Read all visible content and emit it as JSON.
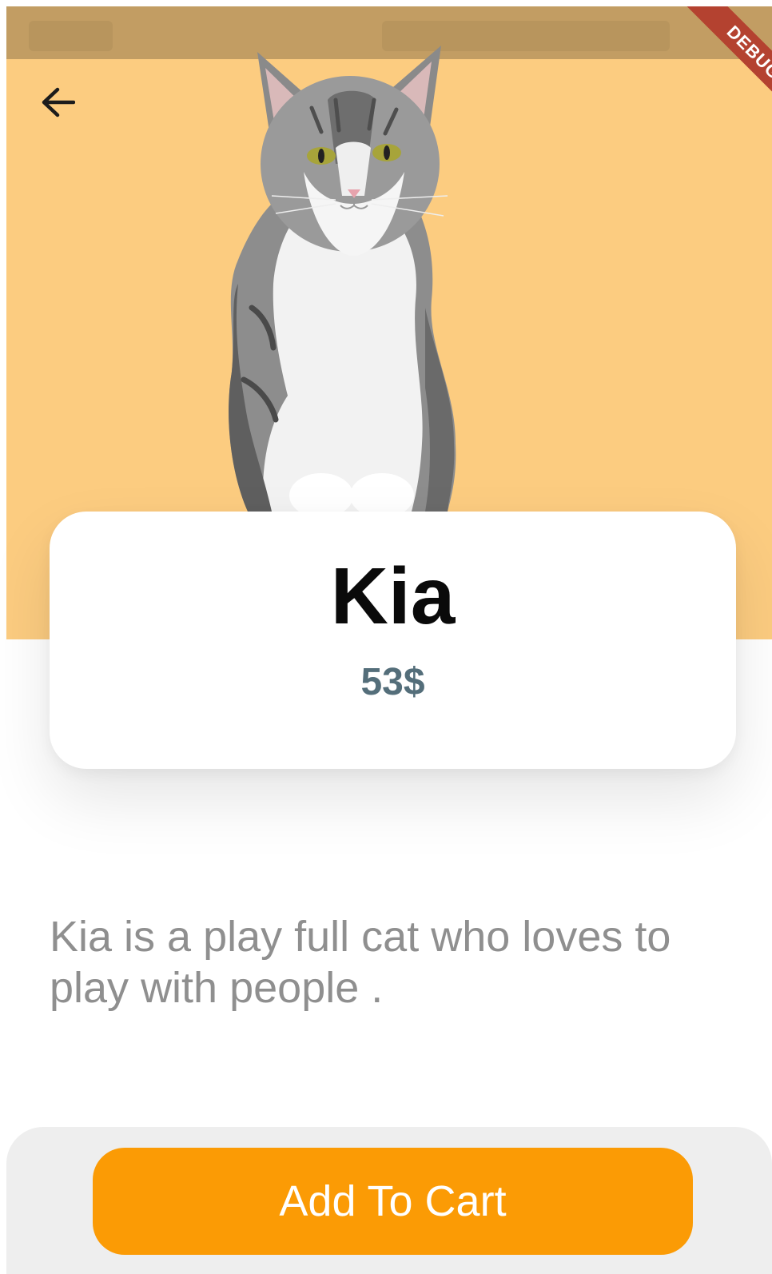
{
  "ribbon": {
    "label": "DEBUG"
  },
  "pet": {
    "name": "Kia",
    "price": "53$",
    "description": "Kia is a play full cat who loves to play with people ."
  },
  "actions": {
    "add_to_cart_label": "Add To Cart"
  },
  "icons": {
    "back": "arrow-left-icon"
  },
  "colors": {
    "hero_background": "#fccc80",
    "status_bar": "#c29d63",
    "price_text": "#546e7a",
    "cart_button": "#fb9b05",
    "debug_ribbon": "#b44230",
    "description_text": "#8f8f8f"
  }
}
